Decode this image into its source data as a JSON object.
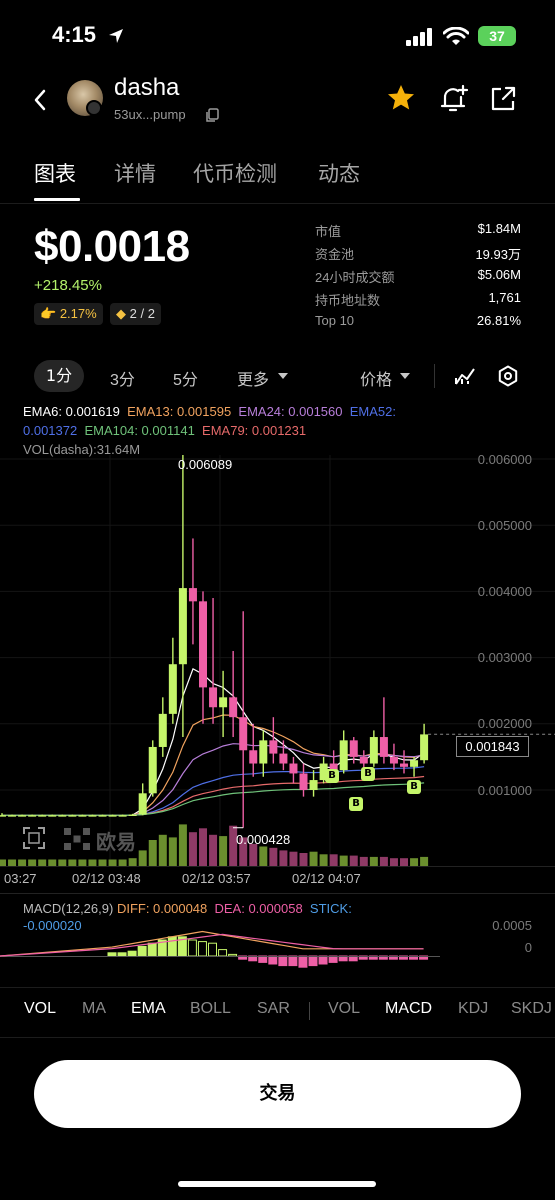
{
  "status_bar": {
    "time": "4:15",
    "battery": "37"
  },
  "header": {
    "token_name": "dasha",
    "token_address": "53ux...pump"
  },
  "tabs": [
    {
      "label": "图表",
      "active": true
    },
    {
      "label": "详情",
      "active": false
    },
    {
      "label": "代币检测",
      "active": false
    },
    {
      "label": "动态",
      "active": false
    }
  ],
  "price": {
    "value": "$0.0018",
    "change": "+218.45%",
    "chip1": "2.17%",
    "chip2": "2 / 2"
  },
  "stats": [
    {
      "label": "市值",
      "value": "$1.84M"
    },
    {
      "label": "资金池",
      "value": "19.93万"
    },
    {
      "label": "24小时成交额",
      "value": "$5.06M"
    },
    {
      "label": "持币地址数",
      "value": "1,761"
    },
    {
      "label": "Top 10",
      "value": "26.81%"
    }
  ],
  "timeframes": {
    "tf1": "1分",
    "tf2": "3分",
    "tf3": "5分",
    "more": "更多",
    "price_type": "价格"
  },
  "ema_legend": {
    "ema6": "EMA6: 0.001619",
    "ema13": "EMA13: 0.001595",
    "ema24": "EMA24: 0.001560",
    "ema52_label": "EMA52:",
    "ema52_value": "0.001372",
    "ema104": "EMA104: 0.001141",
    "ema79": "EMA79: 0.001231",
    "vol": "VOL(dasha):31.64M"
  },
  "chart_labels": {
    "high": "0.006089",
    "low": "0.000428",
    "current": "0.001843",
    "watermark": "欧易",
    "marker": "B"
  },
  "y_axis": [
    "0.006000",
    "0.005000",
    "0.004000",
    "0.003000",
    "0.002000",
    "0.001000"
  ],
  "x_axis": [
    "03:27",
    "02/12 03:48",
    "02/12 03:57",
    "02/12 04:07"
  ],
  "macd": {
    "title": "MACD(12,26,9)",
    "diff": "DIFF: 0.000048",
    "dea": "DEA: 0.000058",
    "stick_label": "STICK:",
    "stick_value": "-0.000020",
    "axis_top": "0.0005",
    "axis_zero": "0"
  },
  "indicators": [
    {
      "label": "VOL",
      "active": true
    },
    {
      "label": "MA",
      "active": false
    },
    {
      "label": "EMA",
      "active": true
    },
    {
      "label": "BOLL",
      "active": false
    },
    {
      "label": "SAR",
      "active": false
    },
    {
      "label": "VOL",
      "active": false
    },
    {
      "label": "MACD",
      "active": true
    },
    {
      "label": "KDJ",
      "active": false
    },
    {
      "label": "SKDJ",
      "active": false
    }
  ],
  "trade_button": "交易",
  "colors": {
    "up": "#c5f56a",
    "down": "#ee5fa6",
    "ema6": "#ffffff",
    "ema13": "#f1a35f",
    "ema24": "#b77ed9",
    "ema52": "#4f6fe6",
    "ema104": "#6fc27a",
    "ema79": "#e66a6a"
  },
  "chart_data": {
    "type": "candlestick",
    "x_ticks": [
      "03:27",
      "02/12 03:48",
      "02/12 03:57",
      "02/12 04:07"
    ],
    "ylim": [
      0,
      0.0065
    ],
    "candles": [
      {
        "o": 0.00062,
        "h": 0.00065,
        "l": 0.0006,
        "c": 0.00062
      },
      {
        "o": 0.00062,
        "h": 0.00063,
        "l": 0.00061,
        "c": 0.00062
      },
      {
        "o": 0.00062,
        "h": 0.00063,
        "l": 0.00061,
        "c": 0.00062
      },
      {
        "o": 0.00062,
        "h": 0.00063,
        "l": 0.00061,
        "c": 0.00062
      },
      {
        "o": 0.00062,
        "h": 0.00063,
        "l": 0.00061,
        "c": 0.00062
      },
      {
        "o": 0.00062,
        "h": 0.00063,
        "l": 0.00061,
        "c": 0.00062
      },
      {
        "o": 0.00062,
        "h": 0.00063,
        "l": 0.00061,
        "c": 0.00062
      },
      {
        "o": 0.00062,
        "h": 0.00063,
        "l": 0.00061,
        "c": 0.00062
      },
      {
        "o": 0.00062,
        "h": 0.00063,
        "l": 0.00061,
        "c": 0.00062
      },
      {
        "o": 0.00062,
        "h": 0.00063,
        "l": 0.00061,
        "c": 0.00062
      },
      {
        "o": 0.00062,
        "h": 0.00063,
        "l": 0.00061,
        "c": 0.00062
      },
      {
        "o": 0.00062,
        "h": 0.00063,
        "l": 0.00061,
        "c": 0.00062
      },
      {
        "o": 0.00062,
        "h": 0.00063,
        "l": 0.00061,
        "c": 0.00062
      },
      {
        "o": 0.00062,
        "h": 0.00064,
        "l": 0.00061,
        "c": 0.00063
      },
      {
        "o": 0.00063,
        "h": 0.0011,
        "l": 0.00062,
        "c": 0.00095
      },
      {
        "o": 0.00095,
        "h": 0.00175,
        "l": 0.0009,
        "c": 0.00165
      },
      {
        "o": 0.00165,
        "h": 0.0024,
        "l": 0.0015,
        "c": 0.00215
      },
      {
        "o": 0.00215,
        "h": 0.0033,
        "l": 0.002,
        "c": 0.0029
      },
      {
        "o": 0.0029,
        "h": 0.00609,
        "l": 0.0018,
        "c": 0.00405
      },
      {
        "o": 0.00405,
        "h": 0.0048,
        "l": 0.0032,
        "c": 0.00385
      },
      {
        "o": 0.00385,
        "h": 0.004,
        "l": 0.002,
        "c": 0.00255
      },
      {
        "o": 0.00255,
        "h": 0.0039,
        "l": 0.002,
        "c": 0.00225
      },
      {
        "o": 0.00225,
        "h": 0.0028,
        "l": 0.0018,
        "c": 0.0024
      },
      {
        "o": 0.0024,
        "h": 0.0031,
        "l": 0.0018,
        "c": 0.0021
      },
      {
        "o": 0.0021,
        "h": 0.0037,
        "l": 0.00043,
        "c": 0.0016
      },
      {
        "o": 0.0016,
        "h": 0.002,
        "l": 0.0012,
        "c": 0.0014
      },
      {
        "o": 0.0014,
        "h": 0.0019,
        "l": 0.0012,
        "c": 0.00175
      },
      {
        "o": 0.00175,
        "h": 0.0021,
        "l": 0.0014,
        "c": 0.00155
      },
      {
        "o": 0.00155,
        "h": 0.00175,
        "l": 0.0013,
        "c": 0.0014
      },
      {
        "o": 0.0014,
        "h": 0.0015,
        "l": 0.0011,
        "c": 0.00125
      },
      {
        "o": 0.00125,
        "h": 0.0014,
        "l": 0.0009,
        "c": 0.001
      },
      {
        "o": 0.001,
        "h": 0.0013,
        "l": 0.0009,
        "c": 0.00115
      },
      {
        "o": 0.00115,
        "h": 0.0015,
        "l": 0.0011,
        "c": 0.0014
      },
      {
        "o": 0.0014,
        "h": 0.0016,
        "l": 0.0012,
        "c": 0.0013
      },
      {
        "o": 0.0013,
        "h": 0.0019,
        "l": 0.00125,
        "c": 0.00175
      },
      {
        "o": 0.00175,
        "h": 0.0018,
        "l": 0.0014,
        "c": 0.0015
      },
      {
        "o": 0.0015,
        "h": 0.0016,
        "l": 0.0013,
        "c": 0.0014
      },
      {
        "o": 0.0014,
        "h": 0.0019,
        "l": 0.00135,
        "c": 0.0018
      },
      {
        "o": 0.0018,
        "h": 0.0024,
        "l": 0.0014,
        "c": 0.0015
      },
      {
        "o": 0.0015,
        "h": 0.0017,
        "l": 0.0013,
        "c": 0.0014
      },
      {
        "o": 0.0014,
        "h": 0.0016,
        "l": 0.00125,
        "c": 0.00135
      },
      {
        "o": 0.00135,
        "h": 0.0015,
        "l": 0.0012,
        "c": 0.00145
      },
      {
        "o": 0.00145,
        "h": 0.002,
        "l": 0.0014,
        "c": 0.00184
      }
    ],
    "volume": [
      0.5,
      0.5,
      0.5,
      0.5,
      0.5,
      0.5,
      0.5,
      0.5,
      0.5,
      0.5,
      0.5,
      0.5,
      0.5,
      0.6,
      1.2,
      2.0,
      2.4,
      2.2,
      3.2,
      2.6,
      2.9,
      2.4,
      2.3,
      3.1,
      2.2,
      1.7,
      1.5,
      1.4,
      1.2,
      1.1,
      1.0,
      1.1,
      0.9,
      0.9,
      0.8,
      0.8,
      0.7,
      0.7,
      0.7,
      0.6,
      0.6,
      0.6,
      0.7
    ],
    "macd_stick": [
      2e-05,
      2e-05,
      3e-05,
      6e-05,
      8e-05,
      0.0001,
      0.00012,
      0.00012,
      0.0001,
      9e-05,
      8e-05,
      4e-05,
      1e-05,
      -2e-05,
      -3e-05,
      -4e-05,
      -5e-05,
      -6e-05,
      -6e-05,
      -7e-05,
      -6e-05,
      -5e-05,
      -4e-05,
      -3e-05,
      -3e-05,
      -2e-05,
      -2e-05,
      -2e-05,
      -2e-05,
      -2e-05,
      -2e-05,
      -2e-05
    ],
    "current_price": 0.001843
  }
}
